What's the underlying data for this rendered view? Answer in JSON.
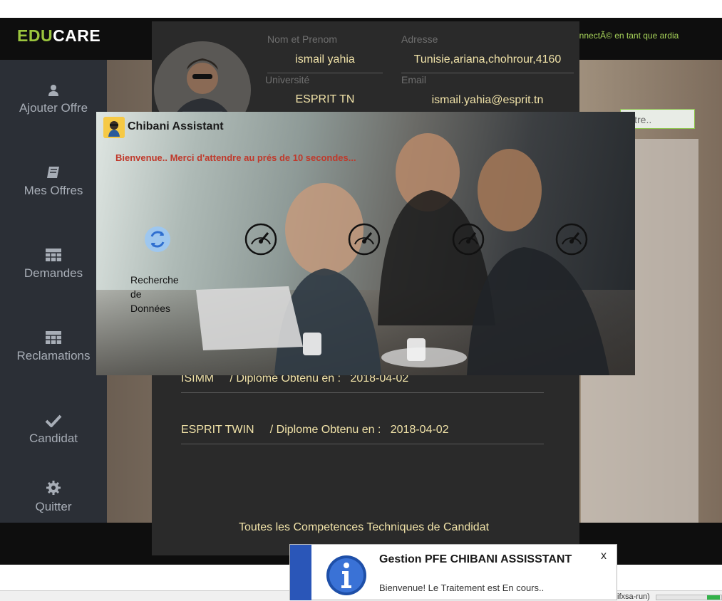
{
  "app": {
    "logo_part1": "EDU",
    "logo_part2": "CARE",
    "connected_text": "connectÃ© en tant que ardia"
  },
  "sidebar": {
    "items": [
      {
        "label": "Ajouter Offre",
        "icon": "user-icon"
      },
      {
        "label": "Mes Offres",
        "icon": "book-icon"
      },
      {
        "label": "Demandes",
        "icon": "table-icon"
      },
      {
        "label": "Reclamations",
        "icon": "table-icon"
      },
      {
        "label": "Candidat",
        "icon": "check-icon"
      },
      {
        "label": "Quitter",
        "icon": "gear-icon"
      }
    ]
  },
  "background": {
    "search_placeholder": "itre.."
  },
  "profile": {
    "fields": {
      "nom_label": "Nom et Prenom",
      "nom_value": "ismail yahia",
      "adresse_label": "Adresse",
      "adresse_value": "Tunisie,ariana,chohrour,4160",
      "universite_label": "Université",
      "universite_value": "ESPRIT TN",
      "email_label": "Email",
      "email_value": "ismail.yahia@esprit.tn"
    },
    "diplomas": [
      {
        "school": "ISIMM",
        "label": "/ Diplome Obtenu en :",
        "date": "2018-04-02"
      },
      {
        "school": "ESPRIT TWIN",
        "label": "/ Diplome Obtenu en :",
        "date": "2018-04-02"
      }
    ],
    "competences_title": "Toutes les Competences Techniques de Candidat"
  },
  "assistant": {
    "title": "Chibani Assistant",
    "welcome": "Bienvenue.. Merci d'attendre au prés de 10 secondes...",
    "step_label": "Recherche de Données",
    "gauge_count": 4
  },
  "notification": {
    "title": "Gestion PFE CHIBANI ASSISSTANT",
    "message": "Bienvenue! Le Traitement est En cours..",
    "close": "x"
  },
  "taskbar": {
    "text": "ifxsa-run)"
  },
  "colors": {
    "accent_green": "#9bc53d",
    "text_gold": "#f0e2a8",
    "welcome_red": "#c0392b",
    "info_blue": "#2a56b8"
  }
}
